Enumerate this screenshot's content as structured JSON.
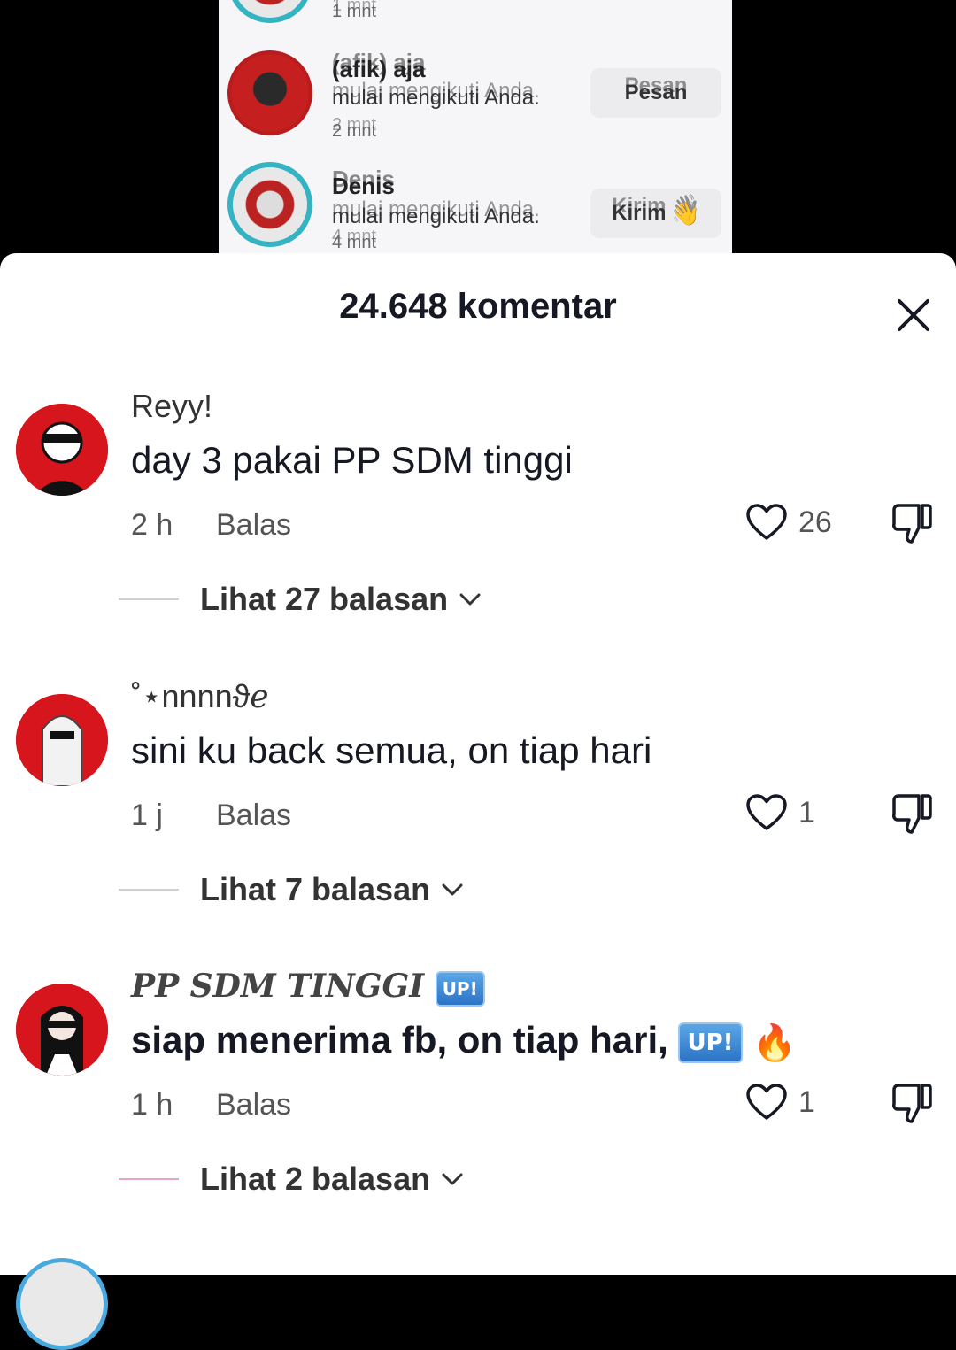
{
  "notifications": [
    {
      "name": "",
      "message": "",
      "time": "1 mnt",
      "action": ""
    },
    {
      "name": "(afik) aja",
      "message": "mulai mengikuti Anda.",
      "time": "2 mnt",
      "action": "Pesan"
    },
    {
      "name": "Denis",
      "message": "mulai mengikuti Anda.",
      "time": "4 mnt",
      "action": "Kirim"
    }
  ],
  "sheet": {
    "title": "24.648 komentar"
  },
  "comments": [
    {
      "username": "Reyy!",
      "text": "day 3 pakai PP SDM tinggi",
      "time": "2 h",
      "reply_label": "Balas",
      "likes": "26",
      "view_replies": "Lihat 27 balasan"
    },
    {
      "username": "˚⋆nnnnϑℯ",
      "text": "sini ku back semua, on tiap hari",
      "time": "1 j",
      "reply_label": "Balas",
      "likes": "1",
      "view_replies": "Lihat 7 balasan"
    },
    {
      "username": "PP SDM TINGGI",
      "username_badge": "UP!",
      "text": "siap menerima fb, on tiap hari,",
      "text_badge": "UP!",
      "text_emoji": "🔥",
      "time": "1 h",
      "reply_label": "Balas",
      "likes": "1",
      "view_replies": "Lihat 2 balasan"
    }
  ],
  "colors": {
    "sheet_bg": "#ffffff",
    "text_primary": "#161823",
    "text_secondary": "#555555",
    "avatar_red": "#d6161c",
    "up_badge": "#2c73c6"
  },
  "icons": [
    "close-icon",
    "heart-icon",
    "dislike-icon",
    "chevron-down-icon",
    "fire-emoji"
  ]
}
